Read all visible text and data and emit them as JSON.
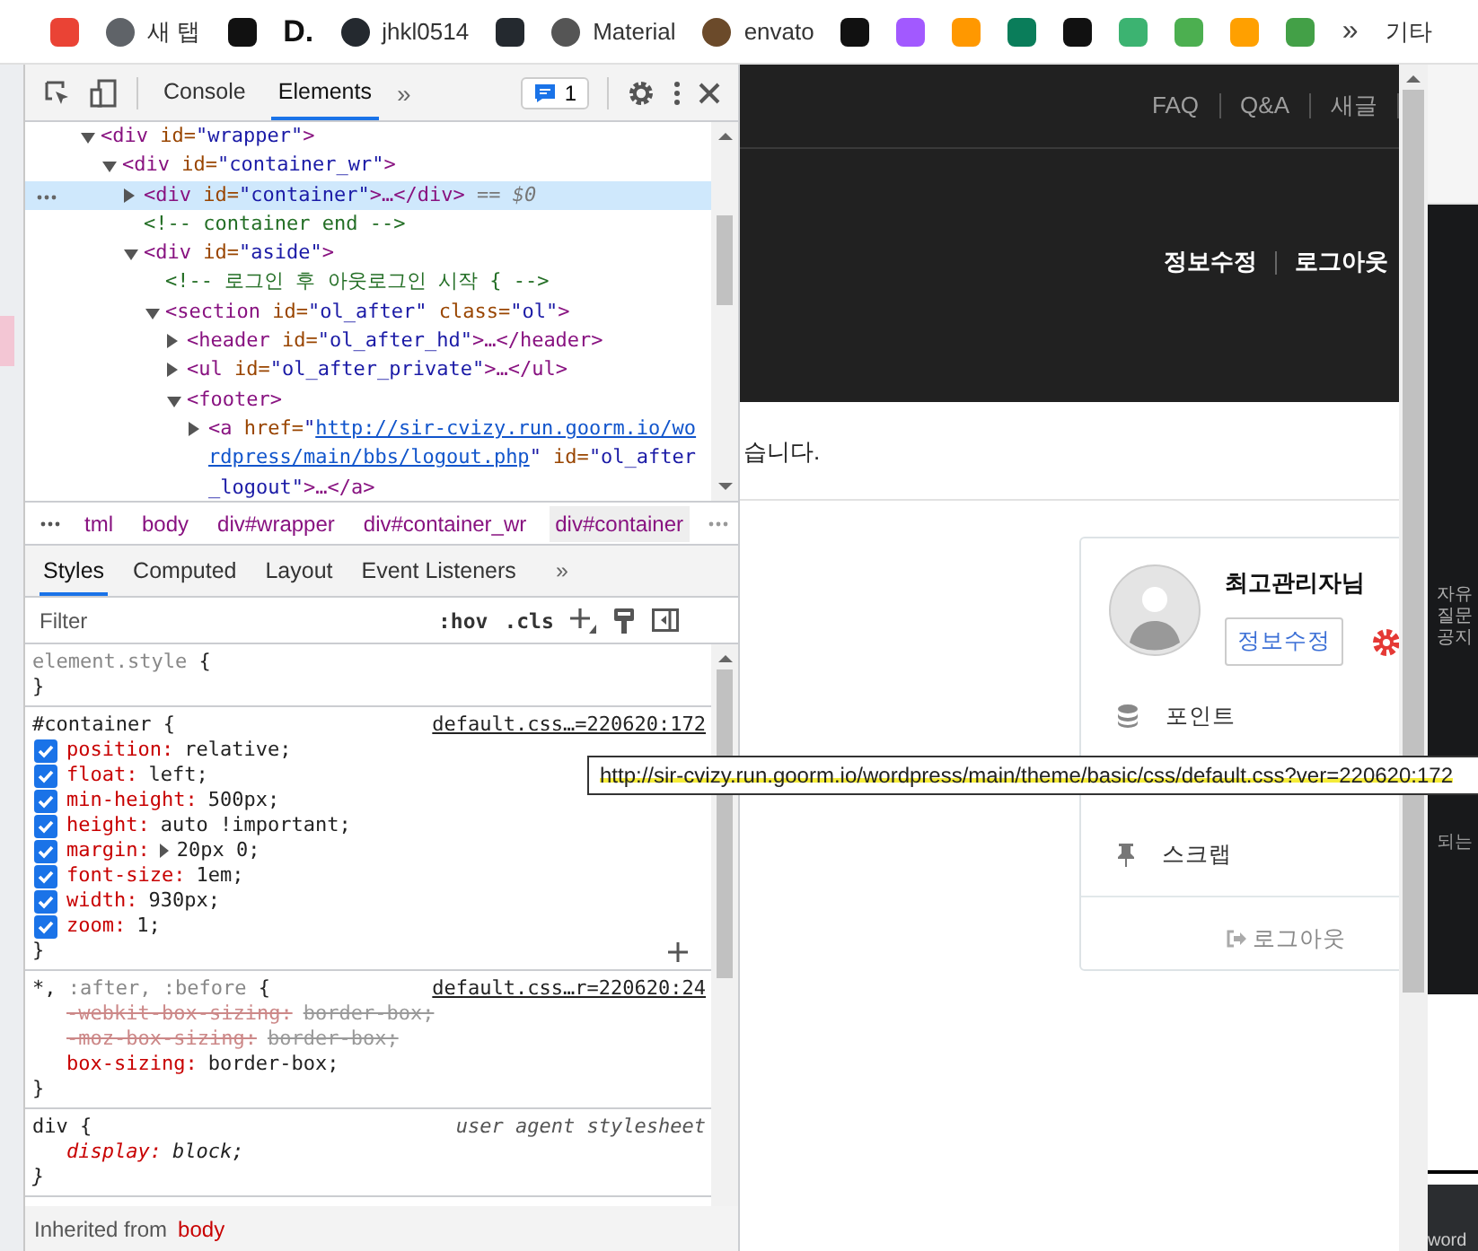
{
  "bookmarks": [
    {
      "kind": "icon"
    },
    {
      "kind": "labeled",
      "label": "새 탭"
    },
    {
      "kind": "icon"
    },
    {
      "kind": "text",
      "label": "D."
    },
    {
      "kind": "labeled",
      "label": "jhkl0514"
    },
    {
      "kind": "icon"
    },
    {
      "kind": "labeled",
      "label": "Material"
    },
    {
      "kind": "labeled",
      "label": "envato"
    },
    {
      "kind": "icon"
    },
    {
      "kind": "icon"
    },
    {
      "kind": "icon"
    },
    {
      "kind": "icon"
    },
    {
      "kind": "icon"
    },
    {
      "kind": "icon"
    },
    {
      "kind": "icon"
    },
    {
      "kind": "icon"
    },
    {
      "kind": "icon"
    }
  ],
  "bookmarks_overflow": "»",
  "other_bookmarks": "기타",
  "devtools": {
    "tabs": [
      {
        "label": "Console",
        "selected": false
      },
      {
        "label": "Elements",
        "selected": true
      }
    ],
    "more_tabs": "»",
    "issues_count": "1",
    "dom": [
      {
        "kind": "element",
        "expanded": true,
        "selected": false,
        "parts": [
          {
            "kind": "tag",
            "text": "<div"
          },
          {
            "kind": "attr",
            "text": " id="
          },
          {
            "kind": "val",
            "text": "\"wrapper\""
          },
          {
            "kind": "tag",
            "text": ">"
          }
        ],
        "children": [
          {
            "kind": "element",
            "expanded": true,
            "selected": false,
            "parts": [
              {
                "kind": "tag",
                "text": "<div"
              },
              {
                "kind": "attr",
                "text": " id="
              },
              {
                "kind": "val",
                "text": "\"container_wr\""
              },
              {
                "kind": "tag",
                "text": ">"
              }
            ],
            "children": [
              {
                "kind": "element",
                "expanded": false,
                "selected": true,
                "parts": [
                  {
                    "kind": "tag",
                    "text": "<div"
                  },
                  {
                    "kind": "attr",
                    "text": " id="
                  },
                  {
                    "kind": "val",
                    "text": "\"container\""
                  },
                  {
                    "kind": "tag",
                    "text": ">…</div>"
                  },
                  {
                    "kind": "eq",
                    "text": " == $0"
                  }
                ]
              },
              {
                "kind": "comment",
                "parts": [
                  {
                    "kind": "comment",
                    "text": "<!-- container end -->"
                  }
                ]
              },
              {
                "kind": "element",
                "expanded": true,
                "selected": false,
                "parts": [
                  {
                    "kind": "tag",
                    "text": "<div"
                  },
                  {
                    "kind": "attr",
                    "text": " id="
                  },
                  {
                    "kind": "val",
                    "text": "\"aside\""
                  },
                  {
                    "kind": "tag",
                    "text": ">"
                  }
                ],
                "children": [
                  {
                    "kind": "comment",
                    "parts": [
                      {
                        "kind": "comment",
                        "text": "<!-- 로그인 후 아웃로그인 시작 { -->"
                      }
                    ]
                  },
                  {
                    "kind": "element",
                    "expanded": true,
                    "selected": false,
                    "parts": [
                      {
                        "kind": "tag",
                        "text": "<section"
                      },
                      {
                        "kind": "attr",
                        "text": " id="
                      },
                      {
                        "kind": "val",
                        "text": "\"ol_after\""
                      },
                      {
                        "kind": "attr",
                        "text": " class="
                      },
                      {
                        "kind": "val",
                        "text": "\"ol\""
                      },
                      {
                        "kind": "tag",
                        "text": ">"
                      }
                    ],
                    "children": [
                      {
                        "kind": "element",
                        "expanded": false,
                        "selected": false,
                        "parts": [
                          {
                            "kind": "tag",
                            "text": "<header"
                          },
                          {
                            "kind": "attr",
                            "text": " id="
                          },
                          {
                            "kind": "val",
                            "text": "\"ol_after_hd\""
                          },
                          {
                            "kind": "tag",
                            "text": ">…</header>"
                          }
                        ]
                      },
                      {
                        "kind": "element",
                        "expanded": false,
                        "selected": false,
                        "parts": [
                          {
                            "kind": "tag",
                            "text": "<ul"
                          },
                          {
                            "kind": "attr",
                            "text": " id="
                          },
                          {
                            "kind": "val",
                            "text": "\"ol_after_private\""
                          },
                          {
                            "kind": "tag",
                            "text": ">…</ul>"
                          }
                        ]
                      },
                      {
                        "kind": "element",
                        "expanded": true,
                        "selected": false,
                        "parts": [
                          {
                            "kind": "tag",
                            "text": "<footer>"
                          }
                        ],
                        "children": [
                          {
                            "kind": "element",
                            "expanded": false,
                            "selected": false,
                            "parts": [
                              {
                                "kind": "tag",
                                "text": "<a"
                              },
                              {
                                "kind": "attr",
                                "text": " href="
                              },
                              {
                                "kind": "val",
                                "text": "\""
                              },
                              {
                                "kind": "link",
                                "text": "http://sir-cvizy.run.goorm.io/wordpress/main/bbs/logout.php"
                              },
                              {
                                "kind": "val",
                                "text": "\""
                              },
                              {
                                "kind": "attr",
                                "text": " id="
                              },
                              {
                                "kind": "val",
                                "text": "\"ol_after_logout\""
                              },
                              {
                                "kind": "tag",
                                "text": ">…</a>"
                              }
                            ]
                          }
                        ]
                      }
                    ]
                  }
                ]
              }
            ]
          }
        ]
      }
    ],
    "breadcrumbs": [
      {
        "label": "tml",
        "selected": false
      },
      {
        "label": "body",
        "selected": false
      },
      {
        "label": "div#wrapper",
        "selected": false
      },
      {
        "label": "div#container_wr",
        "selected": false
      },
      {
        "label": "div#container",
        "selected": true
      }
    ],
    "style_tabs": [
      {
        "label": "Styles",
        "selected": true
      },
      {
        "label": "Computed",
        "selected": false
      },
      {
        "label": "Layout",
        "selected": false
      },
      {
        "label": "Event Listeners",
        "selected": false
      }
    ],
    "more_style_tabs": "»",
    "filter": {
      "placeholder": "Filter"
    },
    "hov": ":hov",
    "cls": ".cls",
    "rules": [
      {
        "kind": "inline",
        "selector": [
          {
            "text": "element.style",
            "matched": false
          },
          {
            "text": " {",
            "matched": true
          }
        ],
        "close": "}",
        "hovered": false
      },
      {
        "kind": "author",
        "selector": [
          {
            "text": "#container {",
            "matched": true
          }
        ],
        "source": "default.css…=220620:172",
        "hovered": true,
        "close": "}",
        "props": [
          {
            "name": "position:",
            "value": "relative;",
            "checked": true,
            "overridden": false
          },
          {
            "name": "float:",
            "value": "left;",
            "checked": true,
            "overridden": false
          },
          {
            "name": "min-height:",
            "value": "500px;",
            "checked": true,
            "overridden": false
          },
          {
            "name": "height:",
            "value": "auto !important;",
            "checked": true,
            "overridden": false
          },
          {
            "name": "margin:",
            "value": "20px 0;",
            "checked": true,
            "overridden": false,
            "expandable": true
          },
          {
            "name": "font-size:",
            "value": "1em;",
            "checked": true,
            "overridden": false
          },
          {
            "name": "width:",
            "value": "930px;",
            "checked": true,
            "overridden": false
          },
          {
            "name": "zoom:",
            "value": "1;",
            "checked": true,
            "overridden": false
          }
        ]
      },
      {
        "kind": "author",
        "selector": [
          {
            "text": "*,",
            "matched": true
          },
          {
            "text": " :after, :before",
            "matched": false
          },
          {
            "text": " {",
            "matched": true
          }
        ],
        "source": "default.css…r=220620:24",
        "hovered": false,
        "close": "}",
        "props": [
          {
            "name": "-webkit-box-sizing:",
            "value": "border-box;",
            "overridden": true
          },
          {
            "name": "-moz-box-sizing:",
            "value": "border-box;",
            "overridden": true
          },
          {
            "name": "box-sizing:",
            "value": "border-box;",
            "overridden": false
          }
        ]
      },
      {
        "kind": "ua",
        "selector": [
          {
            "text": "div {",
            "matched": true
          }
        ],
        "source": "user agent stylesheet",
        "hovered": false,
        "close": "}",
        "props": [
          {
            "name": "display:",
            "value": "block;",
            "overridden": false
          }
        ]
      }
    ],
    "inherited": {
      "label": "Inherited from",
      "from": "body"
    }
  },
  "tooltip": "http://sir-cvizy.run.goorm.io/wordpress/main/theme/basic/css/default.css?ver=220620:172",
  "page": {
    "top_nav": [
      "FAQ",
      "Q&A",
      "새글"
    ],
    "member_links": [
      "정보수정",
      "로그아웃"
    ],
    "notice": "습니다.",
    "profile": {
      "name": "최고관리자님",
      "edit_button": "정보수정",
      "menu": [
        {
          "label": "포인트",
          "kind": "points"
        },
        {
          "label": "스크랩",
          "kind": "scrap"
        }
      ],
      "logout": "로그아웃"
    }
  },
  "side_window": {
    "items": [
      "자유",
      "질문",
      "공지"
    ],
    "fragment": "되는",
    "bottom": "word"
  }
}
